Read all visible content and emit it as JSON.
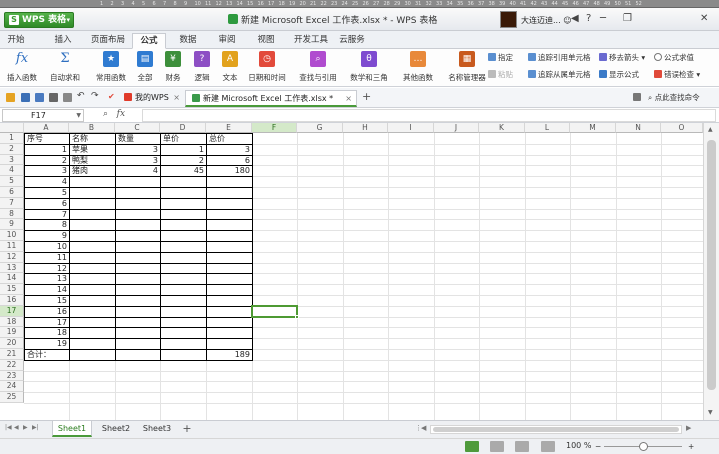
{
  "ruler": {
    "ticks": [
      "1",
      "2",
      "3",
      "4",
      "5",
      "6",
      "7",
      "8",
      "9",
      "10",
      "11",
      "12",
      "13",
      "14",
      "15",
      "16",
      "17",
      "18",
      "19",
      "20",
      "21",
      "22",
      "23",
      "24",
      "25",
      "26",
      "27",
      "28",
      "29",
      "30",
      "31",
      "32",
      "33",
      "34",
      "35",
      "36",
      "37",
      "38",
      "39",
      "40",
      "41",
      "42",
      "43",
      "44",
      "45",
      "46",
      "47",
      "48",
      "49",
      "50",
      "51",
      "52"
    ]
  },
  "titlebar": {
    "app_name": "WPS 表格",
    "app_icon": "S",
    "document_title": "新建 Microsoft Excel 工作表.xlsx * - WPS 表格",
    "user_name": "大连迈迪...",
    "user_caret": "☺",
    "window_controls": [
      "◀",
      "?",
      "─",
      "❐",
      "✕"
    ]
  },
  "ribbon_tabs": [
    "开始",
    "插入",
    "页面布局",
    "公式",
    "数据",
    "审阅",
    "视图",
    "开发工具",
    "云服务"
  ],
  "active_ribbon_tab": "公式",
  "ribbon": {
    "buttons": [
      {
        "label": "插入函数",
        "icon": "fx-icon",
        "color": "#ffffff",
        "glyph": "fx"
      },
      {
        "label": "自动求和",
        "icon": "sigma-icon",
        "color": "#ffffff",
        "glyph": "Σ"
      },
      {
        "label": "常用函数",
        "icon": "star-icon",
        "color": "#2f7bd1",
        "glyph": "★"
      },
      {
        "label": "全部",
        "icon": "list-icon",
        "color": "#2f7bd1",
        "glyph": "▤"
      },
      {
        "label": "财务",
        "icon": "finance-icon",
        "color": "#3d8f3b",
        "glyph": "¥"
      },
      {
        "label": "逻辑",
        "icon": "logic-icon",
        "color": "#8d4fc4",
        "glyph": "?"
      },
      {
        "label": "文本",
        "icon": "text-icon",
        "color": "#e2a21d",
        "glyph": "A"
      },
      {
        "label": "日期和时间",
        "icon": "clock-icon",
        "color": "#e24a3b",
        "glyph": "◷"
      },
      {
        "label": "查找与引用",
        "icon": "lookup-icon",
        "color": "#b04ccf",
        "glyph": "⌕"
      },
      {
        "label": "数学和三角",
        "icon": "math-icon",
        "color": "#7e4bd0",
        "glyph": "θ"
      },
      {
        "label": "其他函数",
        "icon": "more-icon",
        "color": "#e8893a",
        "glyph": "…"
      },
      {
        "label": "名称管理器",
        "icon": "name-manager-icon",
        "color": "#c85a1e",
        "glyph": "▦"
      }
    ],
    "small": {
      "define": "指定",
      "paste": "粘贴",
      "trace_precedents": "追踪引用单元格",
      "trace_dependents": "追踪从属单元格",
      "remove_arrows": "移去箭头",
      "show_formulas": "显示公式",
      "evaluate": "公式求值",
      "error_check": "错误检查"
    }
  },
  "doc_tabs": [
    {
      "label": "我的WPS",
      "icon": "wps-icon",
      "active": false
    },
    {
      "label": "新建 Microsoft Excel 工作表.xlsx *",
      "icon": "excel-doc-icon",
      "active": true
    }
  ],
  "quickbar": {
    "new_tab": "+",
    "search": "点此查找命令"
  },
  "formula_bar": {
    "name_box": "F17",
    "fx": "fx",
    "formula": ""
  },
  "sheet": {
    "columns": [
      "A",
      "B",
      "C",
      "D",
      "E",
      "F",
      "G",
      "H",
      "I",
      "J",
      "K",
      "L",
      "M",
      "N",
      "O"
    ],
    "row_numbers": [
      "1",
      "2",
      "3",
      "4",
      "5",
      "6",
      "7",
      "8",
      "9",
      "10",
      "11",
      "12",
      "13",
      "14",
      "15",
      "16",
      "17",
      "18",
      "19",
      "20",
      "21",
      "22",
      "23",
      "24",
      "25"
    ],
    "cells": [
      {
        "r": 1,
        "c": "A",
        "v": "序号",
        "t": "text"
      },
      {
        "r": 1,
        "c": "B",
        "v": "名称",
        "t": "text"
      },
      {
        "r": 1,
        "c": "C",
        "v": "数量",
        "t": "text"
      },
      {
        "r": 1,
        "c": "D",
        "v": "单价",
        "t": "text"
      },
      {
        "r": 1,
        "c": "E",
        "v": "总价",
        "t": "text"
      },
      {
        "r": 2,
        "c": "A",
        "v": "1",
        "t": "num"
      },
      {
        "r": 2,
        "c": "B",
        "v": "苹果",
        "t": "text"
      },
      {
        "r": 2,
        "c": "C",
        "v": "3",
        "t": "num"
      },
      {
        "r": 2,
        "c": "D",
        "v": "1",
        "t": "num"
      },
      {
        "r": 2,
        "c": "E",
        "v": "3",
        "t": "num"
      },
      {
        "r": 3,
        "c": "A",
        "v": "2",
        "t": "num"
      },
      {
        "r": 3,
        "c": "B",
        "v": "鸭梨",
        "t": "text"
      },
      {
        "r": 3,
        "c": "C",
        "v": "3",
        "t": "num"
      },
      {
        "r": 3,
        "c": "D",
        "v": "2",
        "t": "num"
      },
      {
        "r": 3,
        "c": "E",
        "v": "6",
        "t": "num"
      },
      {
        "r": 4,
        "c": "A",
        "v": "3",
        "t": "num"
      },
      {
        "r": 4,
        "c": "B",
        "v": "猪肉",
        "t": "text"
      },
      {
        "r": 4,
        "c": "C",
        "v": "4",
        "t": "num"
      },
      {
        "r": 4,
        "c": "D",
        "v": "45",
        "t": "num"
      },
      {
        "r": 4,
        "c": "E",
        "v": "180",
        "t": "num"
      },
      {
        "r": 5,
        "c": "A",
        "v": "4",
        "t": "num"
      },
      {
        "r": 6,
        "c": "A",
        "v": "5",
        "t": "num"
      },
      {
        "r": 7,
        "c": "A",
        "v": "6",
        "t": "num"
      },
      {
        "r": 8,
        "c": "A",
        "v": "7",
        "t": "num"
      },
      {
        "r": 9,
        "c": "A",
        "v": "8",
        "t": "num"
      },
      {
        "r": 10,
        "c": "A",
        "v": "9",
        "t": "num"
      },
      {
        "r": 11,
        "c": "A",
        "v": "10",
        "t": "num"
      },
      {
        "r": 12,
        "c": "A",
        "v": "11",
        "t": "num"
      },
      {
        "r": 13,
        "c": "A",
        "v": "12",
        "t": "num"
      },
      {
        "r": 14,
        "c": "A",
        "v": "13",
        "t": "num"
      },
      {
        "r": 15,
        "c": "A",
        "v": "14",
        "t": "num"
      },
      {
        "r": 16,
        "c": "A",
        "v": "15",
        "t": "num"
      },
      {
        "r": 17,
        "c": "A",
        "v": "16",
        "t": "num"
      },
      {
        "r": 18,
        "c": "A",
        "v": "17",
        "t": "num"
      },
      {
        "r": 19,
        "c": "A",
        "v": "18",
        "t": "num"
      },
      {
        "r": 20,
        "c": "A",
        "v": "19",
        "t": "num"
      },
      {
        "r": 21,
        "c": "A",
        "v": "合计：",
        "t": "text"
      },
      {
        "r": 21,
        "c": "E",
        "v": "189",
        "t": "num"
      }
    ],
    "selected": {
      "row": 17,
      "col": "F"
    },
    "bordered_range": {
      "first_row": 1,
      "last_row": 21,
      "first_col": "A",
      "last_col": "E"
    }
  },
  "sheet_tabs": [
    "Sheet1",
    "Sheet2",
    "Sheet3"
  ],
  "active_sheet": "Sheet1",
  "sheet_nav": [
    "|◀",
    "◀",
    "▶",
    "▶|"
  ],
  "status": {
    "zoom": "100 %",
    "zoom_level_percent": 50,
    "minus": "−",
    "plus": "+"
  },
  "colors": {
    "accent_green": "#4e9a33",
    "selected_header": "#d4e9c9"
  }
}
